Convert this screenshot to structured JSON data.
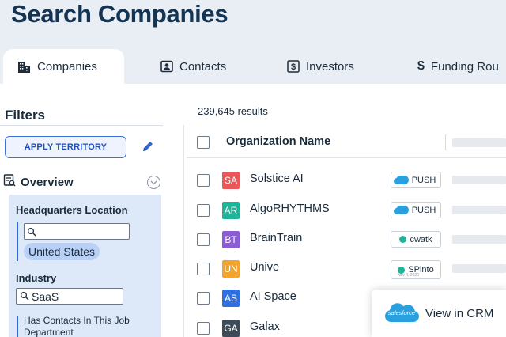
{
  "page": {
    "title": "Search Companies"
  },
  "tabs": [
    {
      "label": "Companies",
      "icon": "building-icon",
      "active": true
    },
    {
      "label": "Contacts",
      "icon": "contact-card-icon",
      "active": false
    },
    {
      "label": "Investors",
      "icon": "dollar-box-icon",
      "active": false
    },
    {
      "label": "Funding Rou",
      "icon": "dollar-icon",
      "active": false
    }
  ],
  "filters": {
    "title": "Filters",
    "apply_label": "APPLY TERRITORY",
    "overview_label": "Overview",
    "hq_label": "Headquarters Location",
    "hq_placeholder": "",
    "hq_chip": "United States",
    "industry_label": "Industry",
    "industry_value": "SaaS",
    "job_label": "Has Contacts In This Job Department"
  },
  "results": {
    "count_text": "239,645 results",
    "column_header": "Organization  Name"
  },
  "rows": [
    {
      "initials": "SA",
      "name": "Solstice AI",
      "logo_color": "#e8585a",
      "crm": "PUSH",
      "crm_type": "salesforce"
    },
    {
      "initials": "AR",
      "name": "AlgoRHYTHMS",
      "logo_color": "#1fb39a",
      "crm": "PUSH",
      "crm_type": "salesforce"
    },
    {
      "initials": "BT",
      "name": "BrainTrain",
      "logo_color": "#8c5bd6",
      "crm": "cwatk",
      "crm_type": "owner"
    },
    {
      "initials": "UN",
      "name": "Unive",
      "logo_color": "#f0a62c",
      "crm": "SPinto",
      "crm_sub": "Nov 4, 2020",
      "crm_type": "owner"
    },
    {
      "initials": "AS",
      "name": "AI Space",
      "logo_color": "#2f6fe4",
      "crm": "",
      "crm_type": "none"
    },
    {
      "initials": "GA",
      "name": "Galax",
      "logo_color": "#3d4a57",
      "crm": "",
      "crm_type": "none"
    }
  ],
  "tooltip": {
    "text": "View in CRM",
    "logo_text": "salesforce"
  },
  "colors": {
    "title": "#143453",
    "accent": "#2f66d0",
    "check": "#1fb39a",
    "salesforce": "#2aa1de"
  }
}
